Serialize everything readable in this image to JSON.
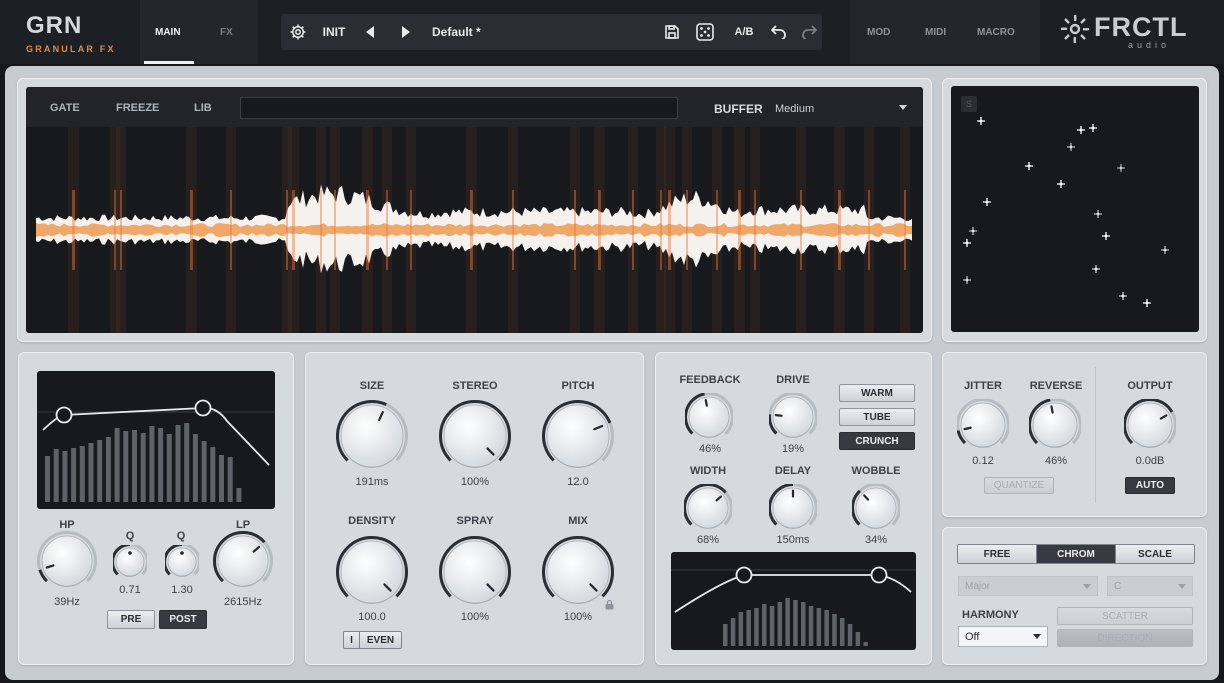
{
  "header": {
    "logo_title": "GRN",
    "logo_subtitle": "GRANULAR FX",
    "tabs": [
      {
        "label": "MAIN",
        "active": true
      },
      {
        "label": "FX",
        "active": false
      }
    ],
    "preset": {
      "init_label": "INIT",
      "name": "Default *",
      "ab_label": "A/B"
    },
    "nav": [
      {
        "label": "MOD"
      },
      {
        "label": "MIDI"
      },
      {
        "label": "MACRO"
      }
    ],
    "brand_name": "FRCTL",
    "brand_sub": "audio"
  },
  "waveform": {
    "buttons": [
      {
        "label": "GATE"
      },
      {
        "label": "FREEZE"
      },
      {
        "label": "LIB"
      }
    ],
    "buffer_label": "BUFFER",
    "buffer_value": "Medium"
  },
  "xy_pad": {
    "badge": "S"
  },
  "filter": {
    "knobs": [
      {
        "label": "HP",
        "value": "39Hz",
        "level": 0.1
      },
      {
        "label": "Q",
        "value": "0.71",
        "level": 0.5
      },
      {
        "label": "Q",
        "value": "1.30",
        "level": 0.5
      },
      {
        "label": "LP",
        "value": "2615Hz",
        "level": 0.68
      }
    ],
    "pre_label": "PRE",
    "post_label": "POST",
    "post_active": true
  },
  "grain": {
    "knobs": [
      {
        "label": "SIZE",
        "value": "191ms",
        "level": 0.59
      },
      {
        "label": "STEREO",
        "value": "100%",
        "level": 1.0
      },
      {
        "label": "PITCH",
        "value": "12.0",
        "level": 0.75
      },
      {
        "label": "DENSITY",
        "value": "100.0",
        "level": 1.0
      },
      {
        "label": "SPRAY",
        "value": "100%",
        "level": 1.0
      },
      {
        "label": "MIX",
        "value": "100%",
        "level": 1.0
      }
    ],
    "toggle": [
      "I",
      "EVEN"
    ]
  },
  "fx": {
    "knobs": [
      {
        "label": "FEEDBACK",
        "value": "46%",
        "level": 0.46
      },
      {
        "label": "DRIVE",
        "value": "19%",
        "level": 0.19
      },
      {
        "label": "WIDTH",
        "value": "68%",
        "level": 0.68
      },
      {
        "label": "DELAY",
        "value": "150ms",
        "level": 0.5
      },
      {
        "label": "WOBBLE",
        "value": "34%",
        "level": 0.34
      }
    ],
    "modes": [
      {
        "label": "WARM",
        "active": false
      },
      {
        "label": "TUBE",
        "active": false
      },
      {
        "label": "CRUNCH",
        "active": true
      }
    ]
  },
  "output": {
    "knobs": [
      {
        "label": "JITTER",
        "value": "0.12",
        "level": 0.12
      },
      {
        "label": "REVERSE",
        "value": "46%",
        "level": 0.46
      },
      {
        "label": "OUTPUT",
        "value": "0.0dB",
        "level": 0.72
      }
    ],
    "quantize_label": "QUANTIZE",
    "auto_label": "AUTO"
  },
  "pitch_mode": {
    "tabs": [
      {
        "label": "FREE",
        "active": false
      },
      {
        "label": "CHROM",
        "active": true
      },
      {
        "label": "SCALE",
        "active": false
      }
    ],
    "scale_value": "Major",
    "key_value": "C",
    "harmony_label": "HARMONY",
    "harmony_value": "Off",
    "scatter_label": "SCATTER",
    "direction_label": "DIRECTION"
  }
}
